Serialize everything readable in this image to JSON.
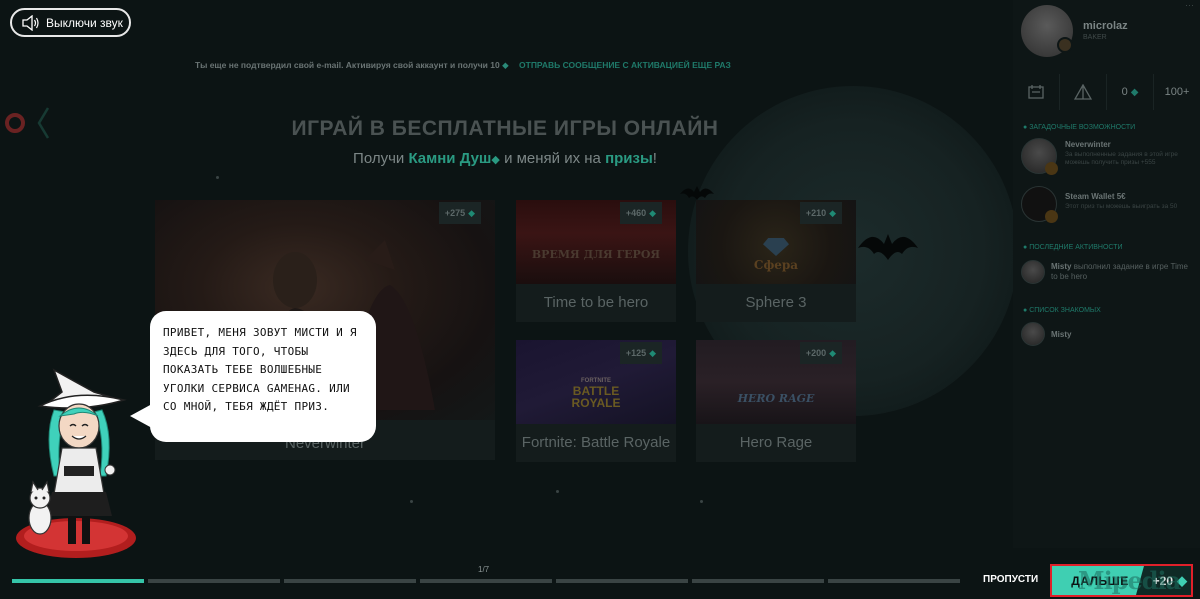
{
  "sound_toggle": {
    "label": "Выключи звук",
    "icon": "speaker-icon"
  },
  "email_notice": {
    "text": "Ты еще не подтвердил свой e-mail. Активируя свой аккаунт и получи 10",
    "resend": "Отправь сообщение с активацией еще раз"
  },
  "hero": {
    "title": "ИГРАЙ В БЕСПЛАТНЫЕ ИГРЫ ОНЛАЙН",
    "subtitle_prefix": "Получи",
    "subtitle_gems": "Камни Душ",
    "subtitle_middle": "и меняй их на",
    "subtitle_prizes": "призы",
    "subtitle_suffix": "!"
  },
  "games": [
    {
      "name": "Neverwinter",
      "points": "+275"
    },
    {
      "name": "Time to be hero",
      "points": "+460",
      "logo": "ВРЕМЯ ДЛЯ ГЕРОЯ"
    },
    {
      "name": "Sphere 3",
      "points": "+210",
      "logo": "Сфера"
    },
    {
      "name": "Fortnite: Battle Royale",
      "points": "+125",
      "logo_top": "FORTNITE",
      "logo_main": "BATTLE ROYALE"
    },
    {
      "name": "Hero Rage",
      "points": "+200",
      "logo": "HERO RAGE"
    }
  ],
  "user": {
    "name": "microlaz",
    "level": "BAKER"
  },
  "stats": {
    "gems": "0",
    "notifications": "100+"
  },
  "sidebar": {
    "recommended_title": "Загадочные возможности",
    "recommended": [
      {
        "title": "Neverwinter",
        "desc": "За выполненные задания в этой игре можешь получить призы +555"
      },
      {
        "title": "Steam Wallet 5€",
        "desc": "Этот приз ты можешь выиграть за 50"
      }
    ],
    "activity_title": "Последние активности",
    "activity": {
      "user": "Misty",
      "text": "выполнил задание в игре Time to be hero"
    },
    "friends_title": "Список знакомых",
    "friend": {
      "name": "Misty"
    }
  },
  "tutorial": {
    "bubble_text": "Привет, меня зовут Мисти и я здесь для того, чтобы показать тебе волшебные уголки сервиса GAMEHAG. Или со мной, тебя ждёт приз.",
    "page": "1/7",
    "skip_label": "ПРОПУСТИ",
    "next_label": "ДАЛЬШЕ",
    "reward": "+20",
    "progress": {
      "current": 1,
      "total": 7
    }
  },
  "watermark": "Mipedia"
}
